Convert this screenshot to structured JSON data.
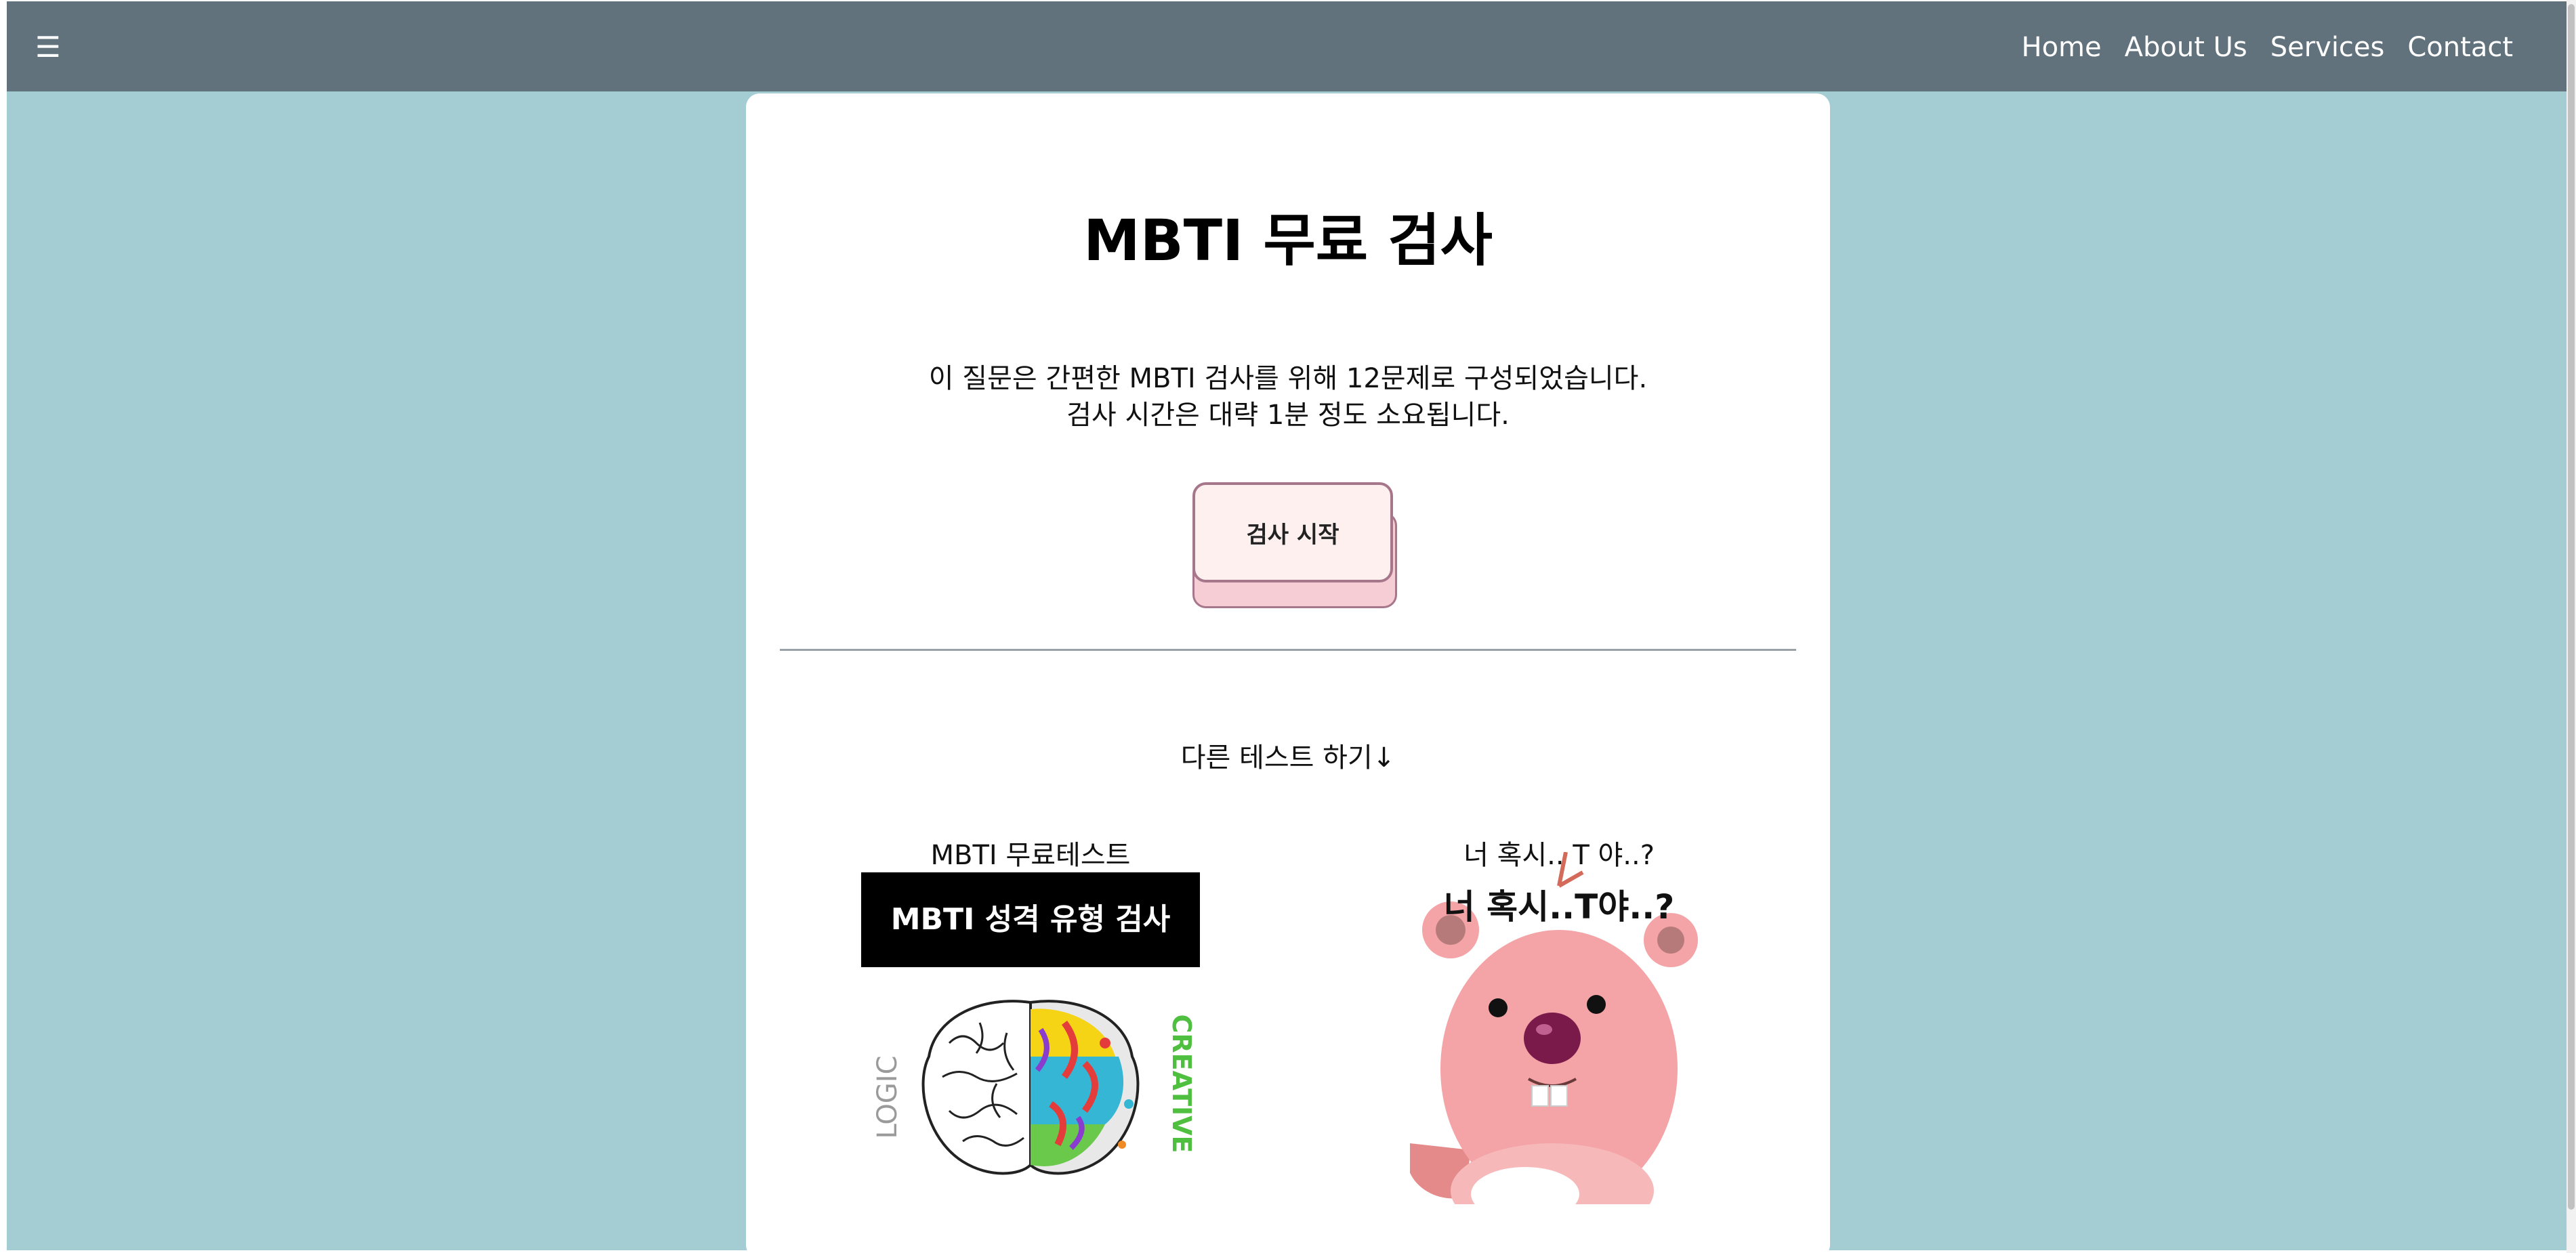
{
  "nav": {
    "menu_icon": "hamburger-icon",
    "menu_glyph": "☰",
    "links": [
      "Home",
      "About Us",
      "Services",
      "Contact"
    ]
  },
  "main": {
    "title": "MBTI 무료 검사",
    "intro_line1": "이 질문은 간편한 MBTI 검사를 위해 12문제로 구성되었습니다.",
    "intro_line2": "검사 시간은 대략 1분 정도 소요됩니다.",
    "start_button": "검사 시작",
    "other_tests_label": "다른 테스트 하기↓"
  },
  "tests": [
    {
      "title": "MBTI 무료테스트",
      "banner_text": "MBTI 성격 유형 검사",
      "image_logic": "LOGIC",
      "image_creative": "CREATIVE"
    },
    {
      "title": "너 혹시.. T 야..?",
      "image_caption": "너 혹시..T야..?"
    }
  ],
  "colors": {
    "background": "#a3cdd3",
    "navbar": "#61727c",
    "card": "#ffffff",
    "button_fill": "#fff0f0",
    "button_border": "#a6778a",
    "button_shadow": "#f7cdd5"
  }
}
